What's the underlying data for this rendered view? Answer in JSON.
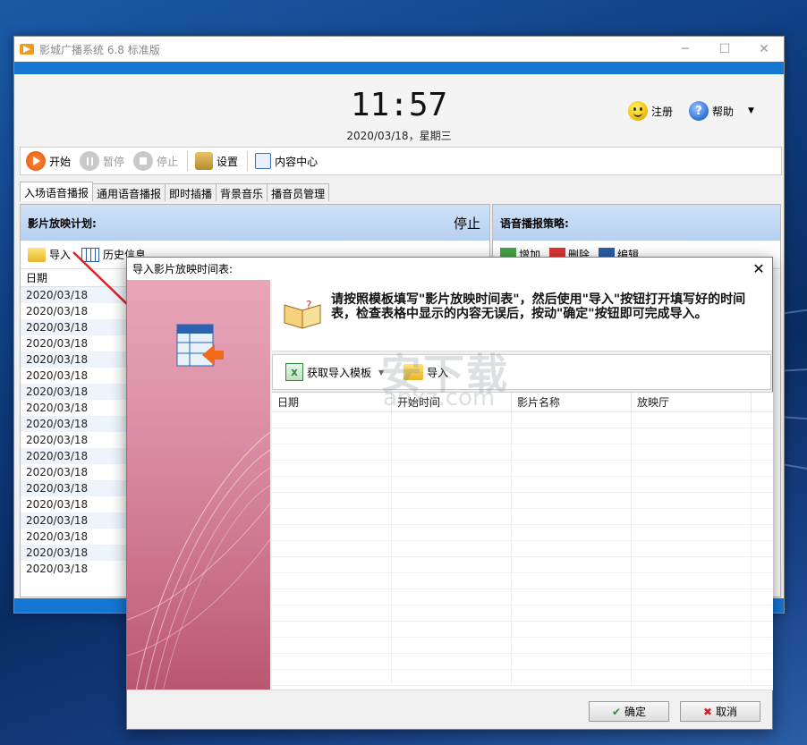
{
  "main_window": {
    "title": "影城广播系统 6.8 标准版",
    "clock": "11:57",
    "date": "2020/03/18，星期三",
    "register_label": "注册",
    "help_label": "帮助",
    "toolbar": {
      "start": "开始",
      "pause": "暂停",
      "stop": "停止",
      "settings": "设置",
      "content_center": "内容中心"
    },
    "tabs": [
      "入场语音播报",
      "通用语音播报",
      "即时插播",
      "背景音乐",
      "播音员管理"
    ],
    "left_panel": {
      "header": "影片放映计划:",
      "status": "停止",
      "import_label": "导入",
      "history_label": "历史信息",
      "date_col": "日期",
      "dates": [
        "2020/03/18",
        "2020/03/18",
        "2020/03/18",
        "2020/03/18",
        "2020/03/18",
        "2020/03/18",
        "2020/03/18",
        "2020/03/18",
        "2020/03/18",
        "2020/03/18",
        "2020/03/18",
        "2020/03/18",
        "2020/03/18",
        "2020/03/18",
        "2020/03/18",
        "2020/03/18",
        "2020/03/18",
        "2020/03/18"
      ]
    },
    "right_panel": {
      "header": "语音播报策略:",
      "add": "增加",
      "delete": "删除",
      "edit": "编辑"
    }
  },
  "dialog": {
    "title": "导入影片放映时间表:",
    "instruction": "请按照模板填写\"影片放映时间表\"，然后使用\"导入\"按钮打开填写好的时间表，检查表格中显示的内容无误后，按动\"确定\"按钮即可完成导入。",
    "get_template": "获取导入模板",
    "import": "导入",
    "columns": [
      "日期",
      "开始时间",
      "影片名称",
      "放映厅"
    ],
    "ok": "确定",
    "cancel": "取消"
  },
  "watermark": {
    "main": "安下载",
    "sub": "anxz.com"
  },
  "colors": {
    "accent_blue": "#1677d2",
    "header_blue": "#b6d0f0",
    "side_pink": "#d98ca3",
    "arrow_red": "#e02020"
  }
}
